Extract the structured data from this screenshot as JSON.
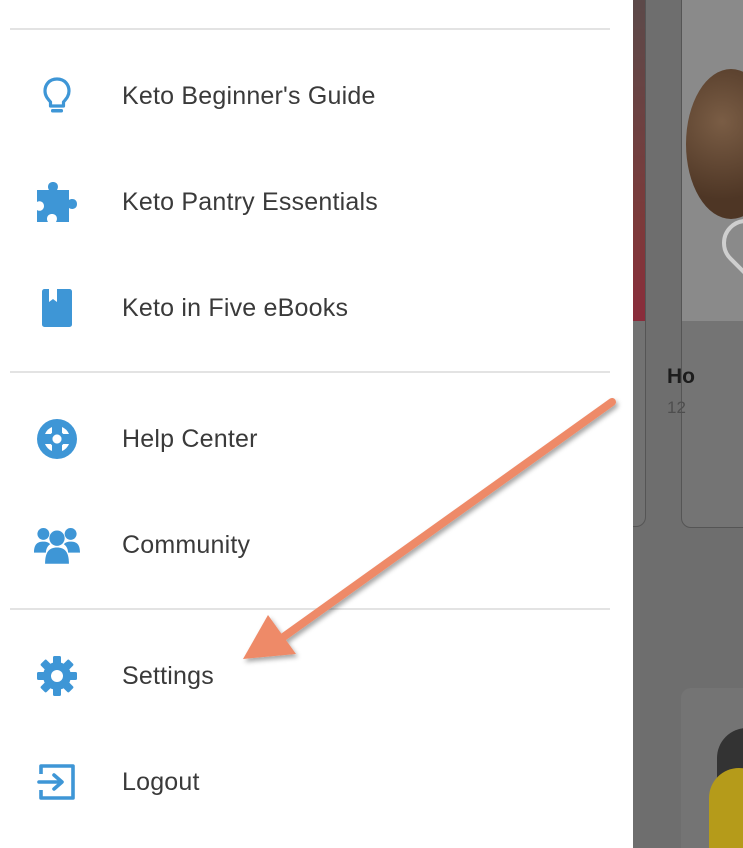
{
  "theme": {
    "accent": "#3e96d6",
    "arrow": "#ee8a67",
    "text": "#3a3a3a"
  },
  "menu": {
    "items": [
      {
        "label": "Keto Beginner's Guide",
        "icon": "lightbulb-icon"
      },
      {
        "label": "Keto Pantry Essentials",
        "icon": "puzzle-icon"
      },
      {
        "label": "Keto in Five eBooks",
        "icon": "book-icon"
      },
      {
        "label": "Help Center",
        "icon": "lifebuoy-icon"
      },
      {
        "label": "Community",
        "icon": "users-icon"
      },
      {
        "label": "Settings",
        "icon": "gear-icon"
      },
      {
        "label": "Logout",
        "icon": "logout-icon"
      }
    ]
  },
  "background": {
    "card_title": "Ho",
    "card_subtitle": "12"
  },
  "annotation": {
    "type": "arrow",
    "points_to": "Settings"
  }
}
